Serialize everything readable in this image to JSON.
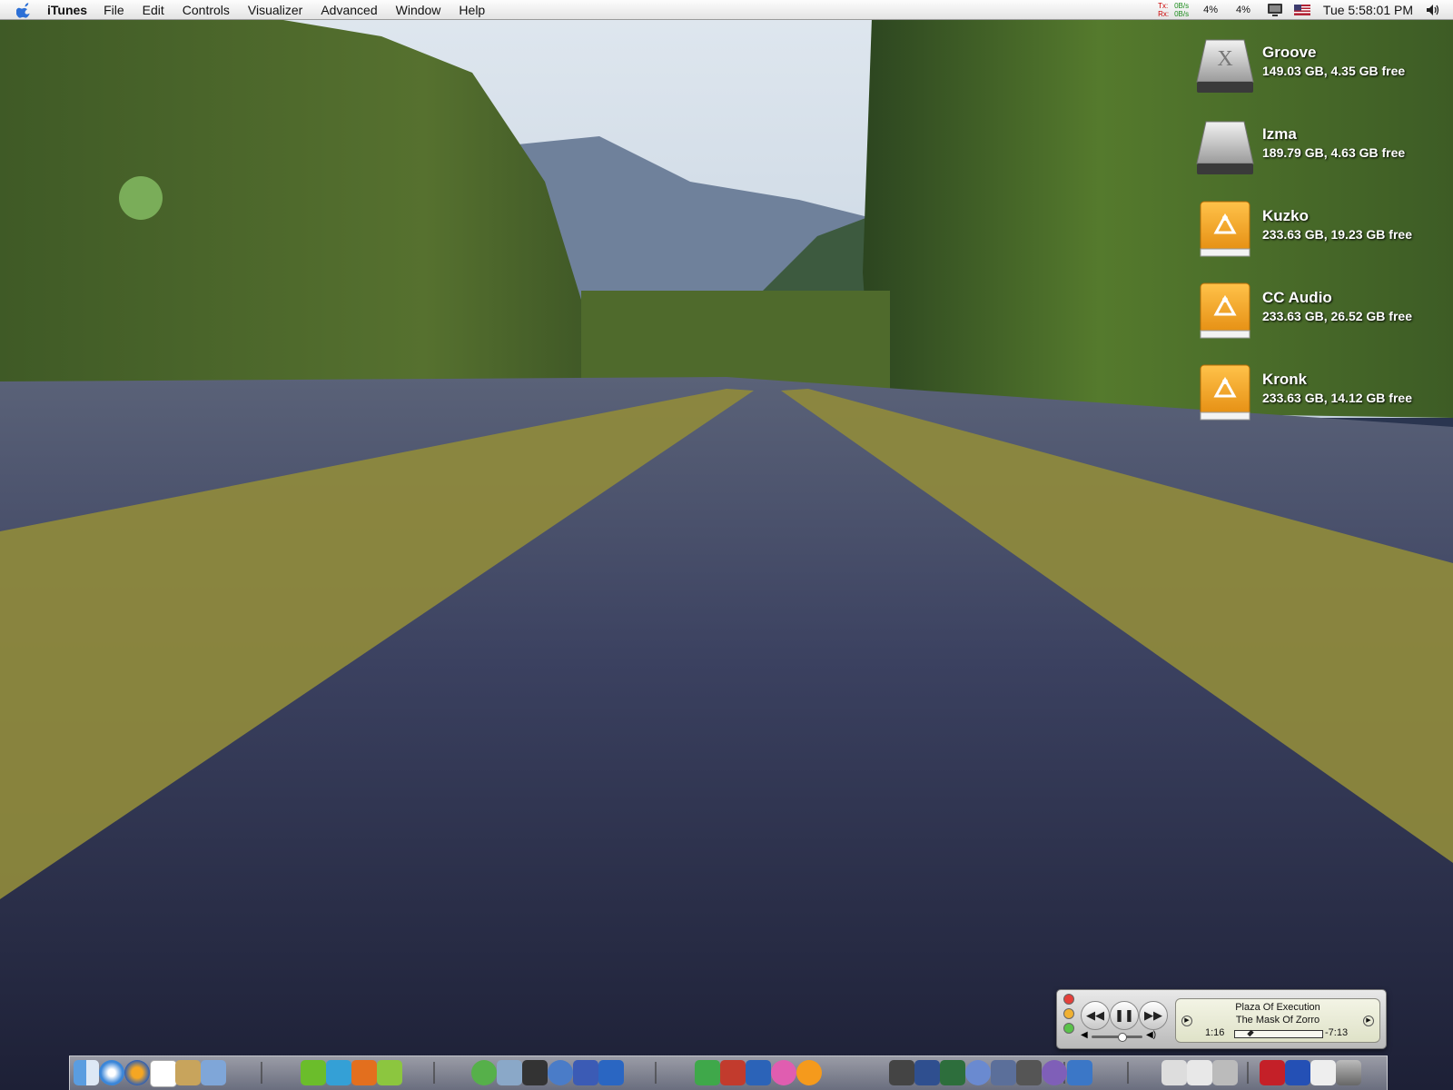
{
  "menubar": {
    "app_name": "iTunes",
    "menus": [
      "File",
      "Edit",
      "Controls",
      "Visualizer",
      "Advanced",
      "Window",
      "Help"
    ],
    "network": {
      "tx_label": "Tx:",
      "rx_label": "Rx:",
      "tx_value": "0B/s",
      "rx_value": "0B/s"
    },
    "cpu1": "4%",
    "cpu2": "4%",
    "clock": "Tue 5:58:01 PM",
    "icons": [
      "apple-icon",
      "display-icon",
      "us-flag-icon",
      "volume-icon"
    ]
  },
  "drives": [
    {
      "name": "Groove",
      "info": "149.03 GB, 4.35 GB free",
      "icon": "osx-hard-drive-icon"
    },
    {
      "name": "Izma",
      "info": "189.79 GB, 4.63 GB free",
      "icon": "hard-drive-icon"
    },
    {
      "name": "Kuzko",
      "info": "233.63 GB, 19.23 GB free",
      "icon": "firewire-drive-icon"
    },
    {
      "name": "CC Audio",
      "info": "233.63 GB, 26.52 GB free",
      "icon": "firewire-drive-icon"
    },
    {
      "name": "Kronk",
      "info": "233.63 GB, 14.12 GB free",
      "icon": "firewire-drive-icon"
    }
  ],
  "player": {
    "song": "Plaza Of Execution",
    "album": "The Mask Of Zorro",
    "elapsed": "1:16",
    "remaining": "-7:13",
    "progress_fraction": 0.15,
    "volume_fraction": 0.6,
    "state": "playing"
  },
  "colors": {
    "drive_orange": "#f2a01a",
    "menu_bg": "#efefef",
    "lcd_bg": "#e9ebd4"
  }
}
